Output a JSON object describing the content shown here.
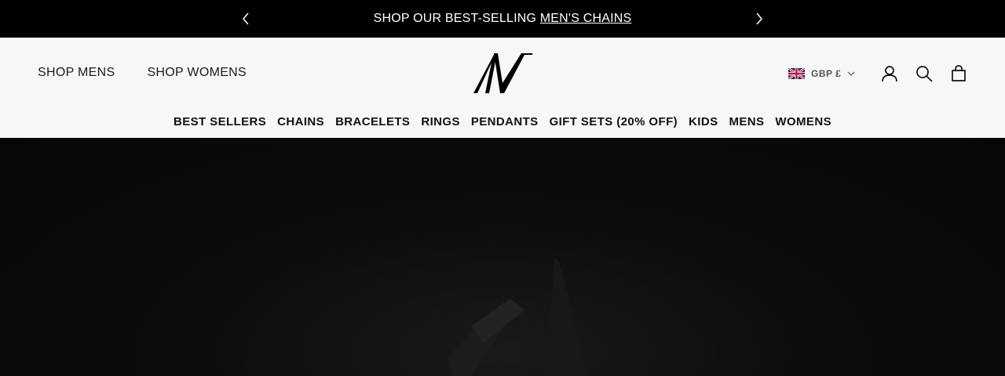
{
  "announcement": {
    "prefix": "SHOP OUR BEST-SELLING ",
    "link_text": "MEN'S CHAINS",
    "prev_icon": "chevron-left-icon",
    "next_icon": "chevron-right-icon"
  },
  "header": {
    "left_nav": [
      "SHOP MENS",
      "SHOP WOMENS"
    ],
    "logo_icon": "av-logo-icon",
    "currency": {
      "flag_icon": "uk-flag-icon",
      "label": "GBP £"
    },
    "icons": [
      "account-icon",
      "search-icon",
      "bag-icon"
    ],
    "main_nav": [
      "BEST SELLERS",
      "CHAINS",
      "BRACELETS",
      "RINGS",
      "PENDANTS",
      "GIFT SETS (20% OFF)",
      "KIDS",
      "MENS",
      "WOMENS"
    ]
  },
  "colors": {
    "announcement_bg": "#000000",
    "header_bg": "#f7f7f7",
    "hero_bg": "#0a0a0a"
  }
}
